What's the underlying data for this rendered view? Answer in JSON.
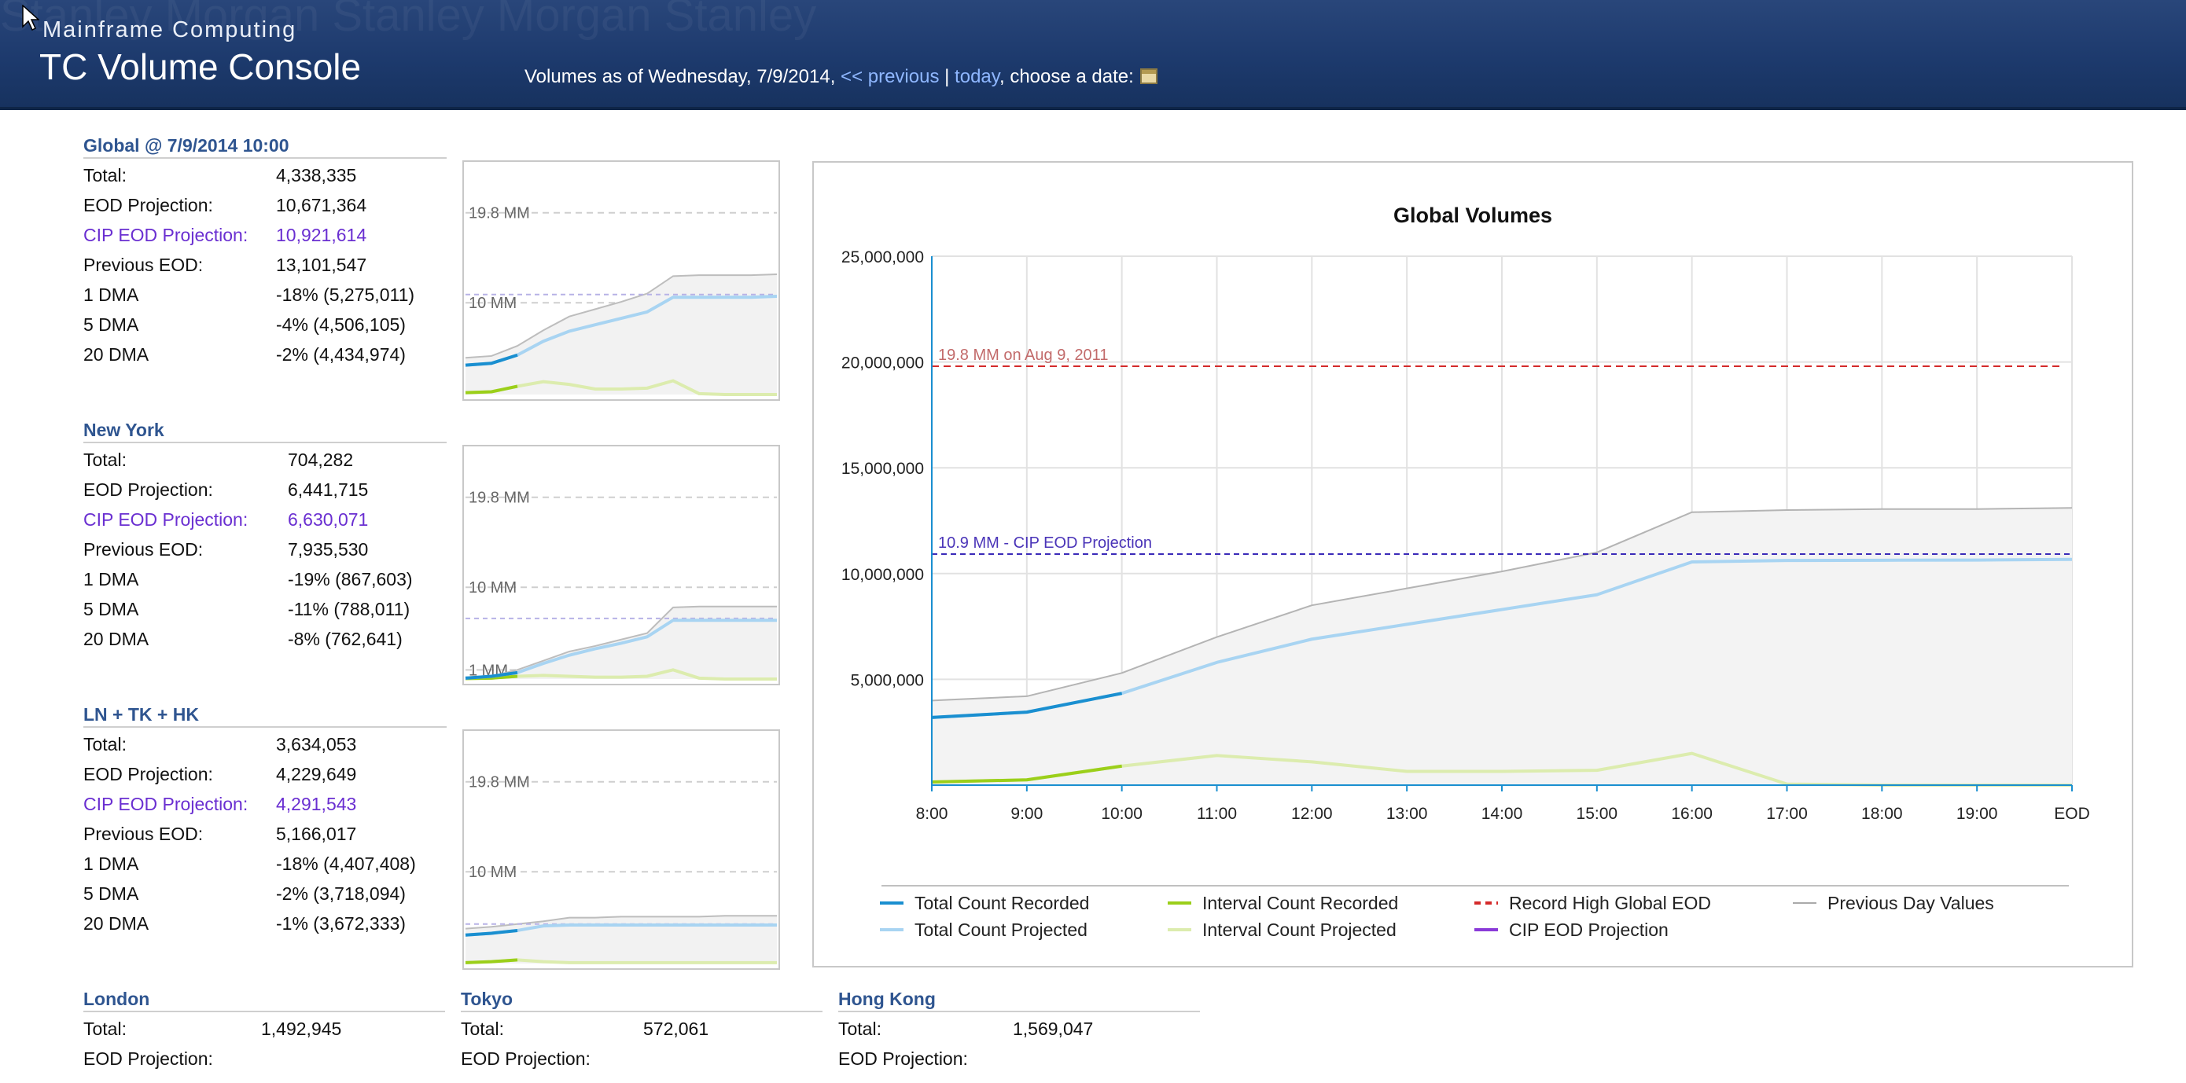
{
  "header": {
    "subtitle": "Mainframe Computing",
    "title": "TC Volume Console",
    "watermark_text": "Stanley Morgan Stanley Morgan Stanley",
    "date_prefix": "Volumes as of Wednesday, 7/9/2014, ",
    "previous_link": "<< previous",
    "separator": " | ",
    "today_link": "today",
    "choose_text": ", choose a date:",
    "calendar_icon": "calendar-icon"
  },
  "regions": [
    {
      "name": "Global @ 7/9/2014 10:00",
      "rows": [
        {
          "label": "Total:",
          "value": "4,338,335"
        },
        {
          "label": "EOD Projection:",
          "value": "10,671,364"
        },
        {
          "label": "CIP EOD Projection:",
          "value": "10,921,614",
          "cip": true
        },
        {
          "label": "Previous EOD:",
          "value": "13,101,547"
        },
        {
          "label": "1 DMA",
          "value": "-18% (5,275,011)"
        },
        {
          "label": "5 DMA",
          "value": "-4% (4,506,105)"
        },
        {
          "label": "20 DMA",
          "value": "-2% (4,434,974)"
        }
      ]
    },
    {
      "name": "New York",
      "rows": [
        {
          "label": "Total:",
          "value": "704,282"
        },
        {
          "label": "EOD Projection:",
          "value": "6,441,715"
        },
        {
          "label": "CIP EOD Projection:",
          "value": "6,630,071",
          "cip": true
        },
        {
          "label": "Previous EOD:",
          "value": "7,935,530"
        },
        {
          "label": "1 DMA",
          "value": "-19% (867,603)"
        },
        {
          "label": "5 DMA",
          "value": "-11% (788,011)"
        },
        {
          "label": "20 DMA",
          "value": "-8% (762,641)"
        }
      ]
    },
    {
      "name": "LN + TK + HK",
      "rows": [
        {
          "label": "Total:",
          "value": "3,634,053"
        },
        {
          "label": "EOD Projection:",
          "value": "4,229,649"
        },
        {
          "label": "CIP EOD Projection:",
          "value": "4,291,543",
          "cip": true
        },
        {
          "label": "Previous EOD:",
          "value": "5,166,017"
        },
        {
          "label": "1 DMA",
          "value": "-18% (4,407,408)"
        },
        {
          "label": "5 DMA",
          "value": "-2% (3,718,094)"
        },
        {
          "label": "20 DMA",
          "value": "-1% (3,672,333)"
        }
      ]
    }
  ],
  "bottom_regions": [
    {
      "name": "London",
      "rows": [
        {
          "label": "Total:",
          "value": "1,492,945"
        },
        {
          "label": "EOD Projection:",
          "value": ""
        }
      ]
    },
    {
      "name": "Tokyo",
      "rows": [
        {
          "label": "Total:",
          "value": "572,061"
        },
        {
          "label": "EOD Projection:",
          "value": ""
        }
      ]
    },
    {
      "name": "Hong Kong",
      "rows": [
        {
          "label": "Total:",
          "value": "1,569,047"
        },
        {
          "label": "EOD Projection:",
          "value": ""
        }
      ]
    }
  ],
  "colors": {
    "total_recorded": "#1a8fd0",
    "total_projected": "#a8d4f2",
    "interval_recorded": "#9bcf1a",
    "interval_projected": "#dcecae",
    "record_high": "#d42a2a",
    "previous_day": "#aaaaaa",
    "cip": "#3a2ab8",
    "cip_legend": "#8a3ad8"
  },
  "spark_labels": [
    "19.8 MM",
    "10 MM",
    "1 MM"
  ],
  "spark_charts": [
    {
      "x": [
        0,
        1,
        2,
        3,
        4,
        5,
        6,
        7,
        8,
        9,
        10,
        11,
        12
      ],
      "previous": [
        4.0,
        4.2,
        5.3,
        7.0,
        8.5,
        9.3,
        10.1,
        11.0,
        12.9,
        13.0,
        13.0,
        13.0,
        13.1
      ],
      "total_recorded": [
        3.2,
        3.4,
        4.3
      ],
      "total_projected": [
        3.2,
        3.4,
        4.3,
        5.8,
        6.9,
        7.6,
        8.3,
        9.0,
        10.6,
        10.6,
        10.6,
        10.6,
        10.7
      ],
      "interval_recorded": [
        0.2,
        0.3,
        0.9
      ],
      "interval_projected": [
        0.2,
        0.3,
        0.9,
        1.4,
        1.1,
        0.6,
        0.6,
        0.7,
        1.5,
        0.1,
        0.0,
        0.0,
        0.0
      ],
      "cip": 10.9
    },
    {
      "x": [
        0,
        1,
        2,
        3,
        4,
        5,
        6,
        7,
        8,
        9,
        10,
        11,
        12
      ],
      "previous": [
        0.2,
        0.3,
        1.0,
        2.0,
        3.0,
        3.6,
        4.3,
        5.0,
        7.8,
        7.9,
        7.9,
        7.9,
        7.9
      ],
      "total_recorded": [
        0.1,
        0.3,
        0.7
      ],
      "total_projected": [
        0.1,
        0.3,
        0.7,
        1.7,
        2.6,
        3.3,
        3.9,
        4.6,
        6.4,
        6.4,
        6.4,
        6.4,
        6.4
      ],
      "interval_recorded": [
        0.05,
        0.1,
        0.3
      ],
      "interval_projected": [
        0.05,
        0.1,
        0.3,
        0.4,
        0.3,
        0.2,
        0.2,
        0.3,
        1.0,
        0.1,
        0.0,
        0.0,
        0.0
      ],
      "cip": 6.6
    },
    {
      "x": [
        0,
        1,
        2,
        3,
        4,
        5,
        6,
        7,
        8,
        9,
        10,
        11,
        12
      ],
      "previous": [
        3.8,
        4.0,
        4.3,
        4.6,
        5.0,
        5.0,
        5.1,
        5.1,
        5.1,
        5.1,
        5.2,
        5.2,
        5.2
      ],
      "total_recorded": [
        3.1,
        3.3,
        3.6
      ],
      "total_projected": [
        3.1,
        3.3,
        3.6,
        4.1,
        4.2,
        4.2,
        4.2,
        4.2,
        4.2,
        4.2,
        4.2,
        4.2,
        4.2
      ],
      "interval_recorded": [
        0.1,
        0.2,
        0.4
      ],
      "interval_projected": [
        0.1,
        0.2,
        0.4,
        0.2,
        0.1,
        0.1,
        0.1,
        0.1,
        0.1,
        0.1,
        0.1,
        0.1,
        0.1
      ],
      "cip": 4.3
    }
  ],
  "chart_data": {
    "type": "line",
    "title": "Global Volumes",
    "categories": [
      "8:00",
      "9:00",
      "10:00",
      "11:00",
      "12:00",
      "13:00",
      "14:00",
      "15:00",
      "16:00",
      "17:00",
      "18:00",
      "19:00",
      "EOD"
    ],
    "yticks": [
      "25,000,000",
      "20,000,000",
      "15,000,000",
      "10,000,000",
      "5,000,000"
    ],
    "ytick_values": [
      25000000,
      20000000,
      15000000,
      10000000,
      5000000
    ],
    "ylim": [
      0,
      25000000
    ],
    "grid": true,
    "legend_position": "bottom",
    "series": [
      {
        "name": "Total Count Recorded",
        "values": [
          3200000,
          3450000,
          4338335
        ]
      },
      {
        "name": "Total Count Projected",
        "values": [
          3200000,
          3450000,
          4338335,
          5800000,
          6900000,
          7600000,
          8300000,
          9000000,
          10550000,
          10620000,
          10630000,
          10640000,
          10671364
        ]
      },
      {
        "name": "Interval Count Recorded",
        "values": [
          150000,
          250000,
          900000
        ]
      },
      {
        "name": "Interval Count Projected",
        "values": [
          150000,
          250000,
          900000,
          1400000,
          1100000,
          650000,
          650000,
          700000,
          1500000,
          50000,
          0,
          0,
          0
        ]
      },
      {
        "name": "Previous Day Values",
        "values": [
          4000000,
          4200000,
          5300000,
          7000000,
          8500000,
          9300000,
          10100000,
          11000000,
          12900000,
          13000000,
          13050000,
          13050000,
          13101547
        ]
      }
    ],
    "reference_lines": [
      {
        "name": "Record High Global EOD",
        "value": 19800000,
        "label": "19.8 MM on Aug 9, 2011"
      },
      {
        "name": "CIP EOD Projection",
        "value": 10921614,
        "label": "10.9 MM - CIP EOD Projection"
      }
    ],
    "legend": [
      {
        "name": "Total Count Recorded",
        "style": "solid",
        "color": "#1a8fd0"
      },
      {
        "name": "Interval Count Recorded",
        "style": "solid",
        "color": "#9bcf1a"
      },
      {
        "name": "Record High Global EOD",
        "style": "dashed",
        "color": "#d42a2a"
      },
      {
        "name": "Previous Day Values",
        "style": "solid",
        "color": "#aaaaaa"
      },
      {
        "name": "Total Count Projected",
        "style": "solid",
        "color": "#a8d4f2"
      },
      {
        "name": "Interval Count Projected",
        "style": "solid",
        "color": "#dcecae"
      },
      {
        "name": "CIP EOD Projection",
        "style": "solid",
        "color": "#8a3ad8"
      }
    ]
  }
}
